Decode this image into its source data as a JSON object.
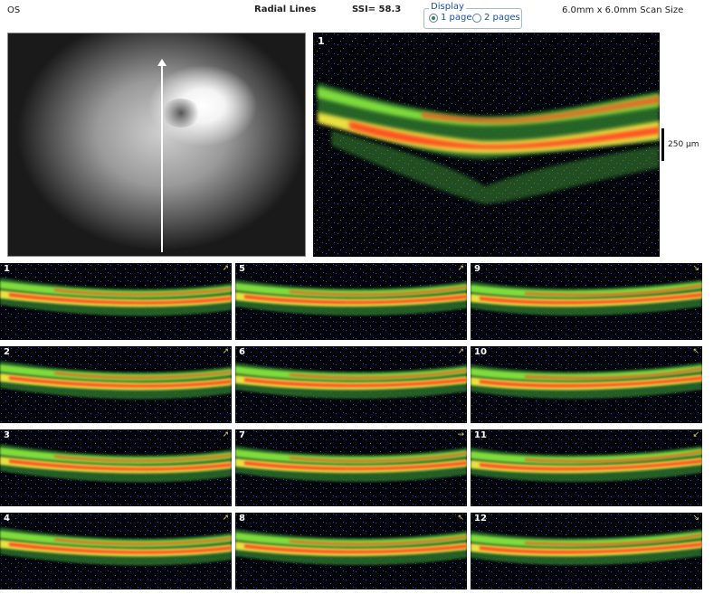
{
  "header": {
    "eye": "OS",
    "scan_type": "Radial Lines",
    "ssi": "SSI= 58.3",
    "display_label": "Display",
    "display_options": [
      "1 page",
      "2 pages"
    ],
    "selected_option": "1 page",
    "scan_size": "6.0mm x 6.0mm Scan Size"
  },
  "main_scan": {
    "number": "1",
    "scale_label": "250 µm"
  },
  "colors": {
    "background": "#03030a",
    "retina_green": "#7fdc3a",
    "retina_yellow": "#e8e040",
    "retina_red": "#ff5020",
    "noise_blue": "#2a4cc8"
  },
  "thumbnails": [
    {
      "number": "1"
    },
    {
      "number": "5"
    },
    {
      "number": "9"
    },
    {
      "number": "2"
    },
    {
      "number": "6"
    },
    {
      "number": "10"
    },
    {
      "number": "3"
    },
    {
      "number": "7"
    },
    {
      "number": "11"
    },
    {
      "number": "4"
    },
    {
      "number": "8"
    },
    {
      "number": "12"
    }
  ]
}
